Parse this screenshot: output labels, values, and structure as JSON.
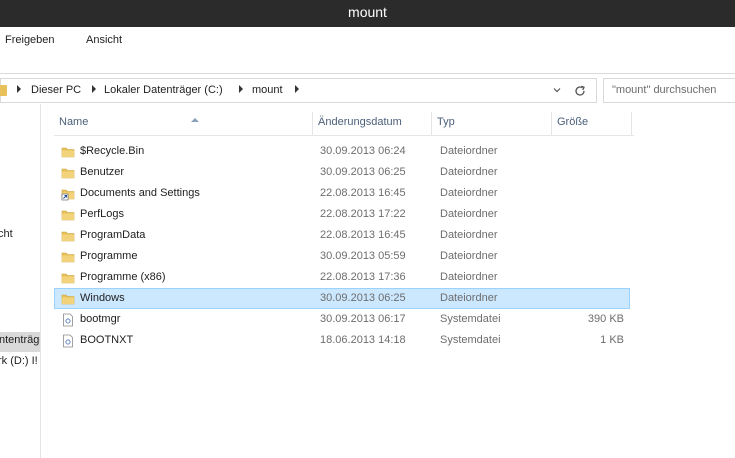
{
  "window": {
    "title": "mount"
  },
  "ribbon": {
    "tabs": [
      "Freigeben",
      "Ansicht"
    ]
  },
  "address": {
    "crumbs": [
      "Dieser PC",
      "Lokaler Datenträger (C:)",
      "mount"
    ]
  },
  "search": {
    "placeholder": "\"mount\" durchsuchen"
  },
  "nav": {
    "partial_items": [
      "cht",
      "ntenträger",
      "rk (D:) I!"
    ]
  },
  "columns": {
    "name": "Name",
    "date": "Änderungsdatum",
    "type": "Typ",
    "size": "Größe",
    "sorted_by": "name"
  },
  "files": [
    {
      "name": "$Recycle.Bin",
      "date": "30.09.2013 06:24",
      "type": "Dateiordner",
      "size": "",
      "icon": "folder-icon"
    },
    {
      "name": "Benutzer",
      "date": "30.09.2013 06:25",
      "type": "Dateiordner",
      "size": "",
      "icon": "folder-icon"
    },
    {
      "name": "Documents and Settings",
      "date": "22.08.2013 16:45",
      "type": "Dateiordner",
      "size": "",
      "icon": "folder-shortcut-icon"
    },
    {
      "name": "PerfLogs",
      "date": "22.08.2013 17:22",
      "type": "Dateiordner",
      "size": "",
      "icon": "folder-icon"
    },
    {
      "name": "ProgramData",
      "date": "22.08.2013 16:45",
      "type": "Dateiordner",
      "size": "",
      "icon": "folder-icon"
    },
    {
      "name": "Programme",
      "date": "30.09.2013 05:59",
      "type": "Dateiordner",
      "size": "",
      "icon": "folder-icon"
    },
    {
      "name": "Programme (x86)",
      "date": "22.08.2013 17:36",
      "type": "Dateiordner",
      "size": "",
      "icon": "folder-icon"
    },
    {
      "name": "Windows",
      "date": "30.09.2013 06:25",
      "type": "Dateiordner",
      "size": "",
      "icon": "folder-icon",
      "selected": true
    },
    {
      "name": "bootmgr",
      "date": "30.09.2013 06:17",
      "type": "Systemdatei",
      "size": "390 KB",
      "icon": "system-file-icon"
    },
    {
      "name": "BOOTNXT",
      "date": "18.06.2013 14:18",
      "type": "Systemdatei",
      "size": "1 KB",
      "icon": "system-file-icon"
    }
  ],
  "colors": {
    "titlebar": "#2b2b2b",
    "selection": "#cce8ff",
    "selection_border": "#99d1ff",
    "folder": "#e8c15a",
    "header_text": "#4c607a"
  }
}
